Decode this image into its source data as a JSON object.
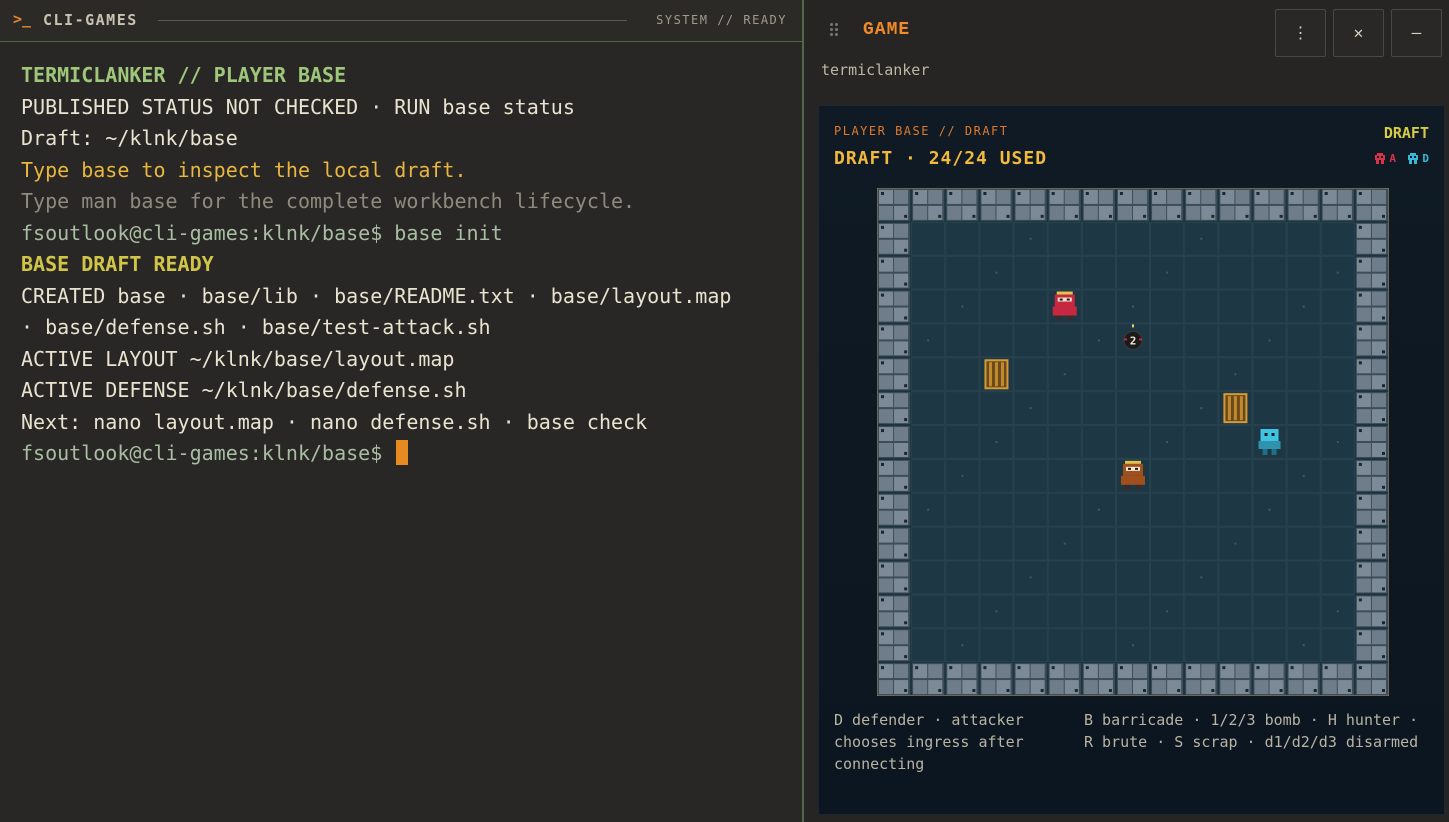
{
  "terminal": {
    "prompt_icon": ">_",
    "title": "CLI-GAMES",
    "status": "SYSTEM // READY",
    "lines": [
      {
        "text": "TERMICLANKER // PLAYER BASE",
        "style": "green"
      },
      {
        "text": "PUBLISHED STATUS NOT CHECKED · RUN base status",
        "style": "white"
      },
      {
        "text": "Draft: ~/klnk/base",
        "style": "white"
      },
      {
        "text": "Type base to inspect the local draft.",
        "style": "yellow"
      },
      {
        "text": "Type man base for the complete workbench lifecycle.",
        "style": "gray"
      },
      {
        "text": "fsoutlook@cli-games:klnk/base$ base init",
        "style": "prompt"
      },
      {
        "text": "BASE DRAFT READY",
        "style": "ready"
      },
      {
        "text": "CREATED base · base/lib · base/README.txt · base/layout.map",
        "style": "white"
      },
      {
        "text": "· base/defense.sh · base/test-attack.sh",
        "style": "white"
      },
      {
        "text": "ACTIVE LAYOUT ~/klnk/base/layout.map",
        "style": "white"
      },
      {
        "text": "ACTIVE DEFENSE ~/klnk/base/defense.sh",
        "style": "white"
      },
      {
        "text": "Next: nano layout.map · nano defense.sh · base check",
        "style": "white"
      }
    ],
    "current_prompt": "fsoutlook@cli-games:klnk/base$ "
  },
  "game": {
    "title": "GAME",
    "subtitle": "termiclanker",
    "buttons": {
      "more": "⋮",
      "close": "✕",
      "minimize": "—"
    },
    "card": {
      "label": "PLAYER BASE // DRAFT",
      "status": "DRAFT · 24/24 USED",
      "mode": "DRAFT",
      "legend": [
        {
          "key": "A",
          "color": "#d8334a"
        },
        {
          "key": "D",
          "color": "#39b9d8"
        }
      ],
      "board": {
        "cols": 15,
        "rows": 15,
        "pieces": [
          {
            "kind": "hunter-bot",
            "col": 5,
            "row": 3,
            "color": "#c8283f"
          },
          {
            "kind": "bomb",
            "col": 7,
            "row": 4,
            "label": "2"
          },
          {
            "kind": "barricade",
            "col": 3,
            "row": 5
          },
          {
            "kind": "barricade",
            "col": 10,
            "row": 6
          },
          {
            "kind": "defender-bot",
            "col": 11,
            "row": 7,
            "color": "#3ec3e0"
          },
          {
            "kind": "brute-bot",
            "col": 7,
            "row": 8,
            "color": "#a0501f"
          }
        ]
      },
      "legend_text_left": "D defender · attacker chooses ingress after connecting",
      "legend_text_right": "B barricade · 1/2/3 bomb · H hunter · R brute · S scrap · d1/d2/d3 disarmed"
    }
  }
}
